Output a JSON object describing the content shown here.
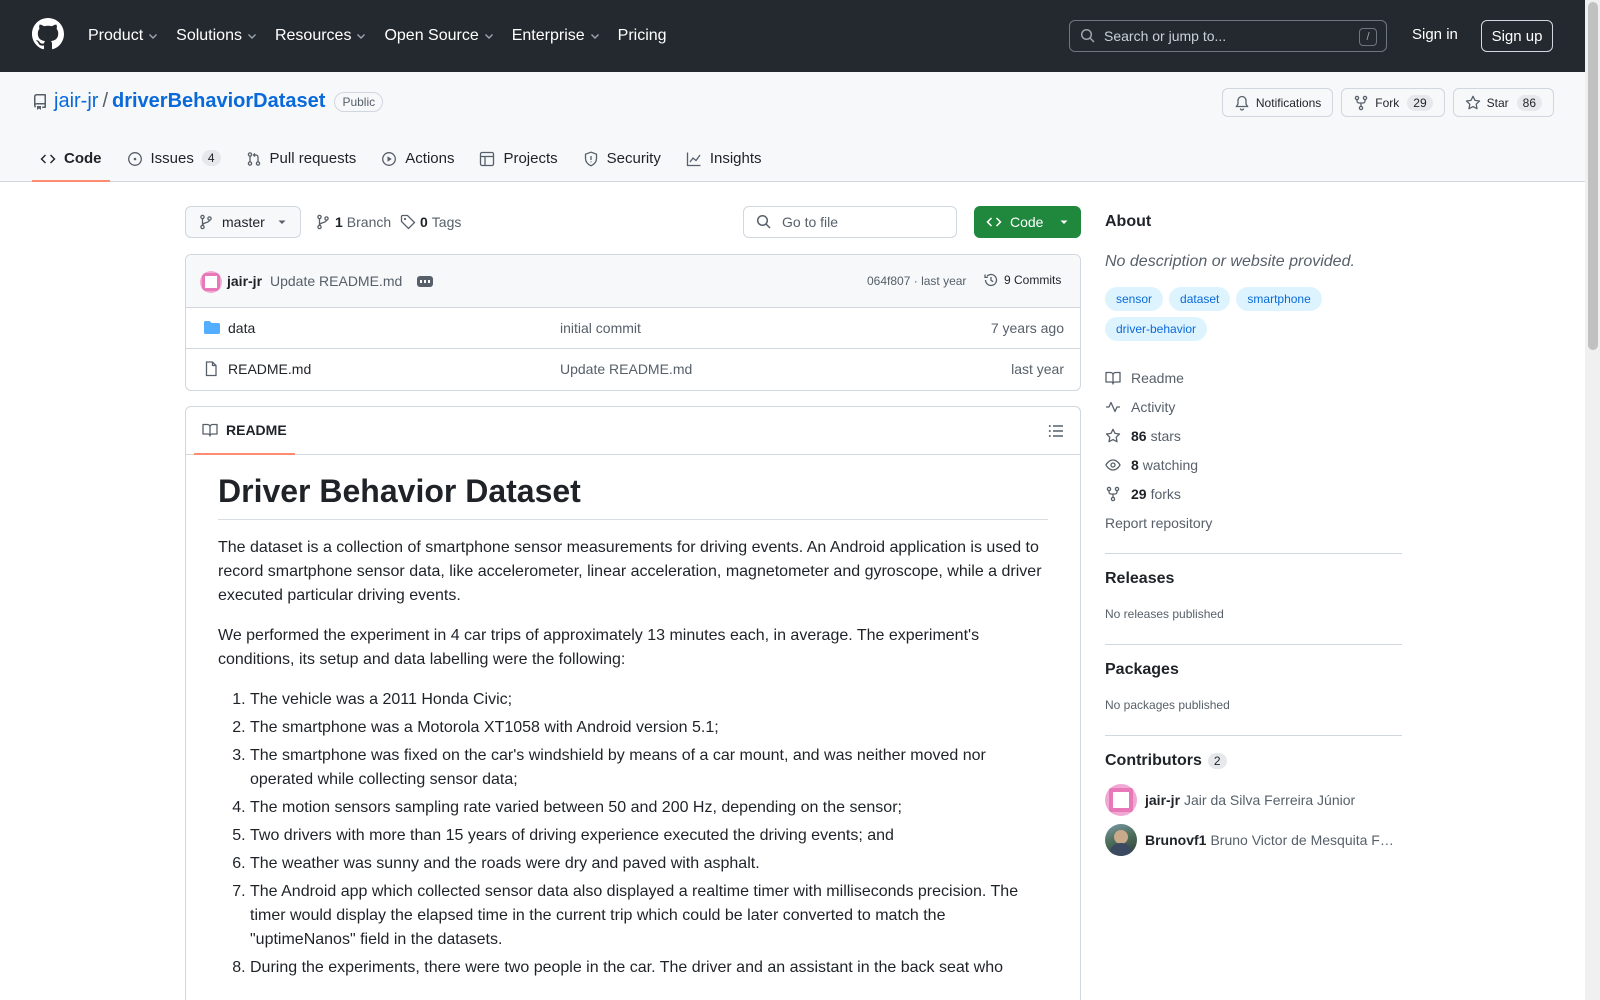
{
  "nav": {
    "items": [
      "Product",
      "Solutions",
      "Resources",
      "Open Source",
      "Enterprise",
      "Pricing"
    ],
    "search_placeholder": "Search or jump to...",
    "search_key": "/",
    "sign_in": "Sign in",
    "sign_up": "Sign up"
  },
  "repo": {
    "owner": "jair-jr",
    "separator": "/",
    "name": "driverBehaviorDataset",
    "visibility": "Public",
    "notifications_label": "Notifications",
    "fork_label": "Fork",
    "fork_count": "29",
    "star_label": "Star",
    "star_count": "86"
  },
  "tabs": [
    {
      "label": "Code",
      "active": true
    },
    {
      "label": "Issues",
      "count": "4"
    },
    {
      "label": "Pull requests"
    },
    {
      "label": "Actions"
    },
    {
      "label": "Projects"
    },
    {
      "label": "Security"
    },
    {
      "label": "Insights"
    }
  ],
  "toolbar": {
    "branch": "master",
    "branch_count": "1",
    "branch_label": "Branch",
    "tag_count": "0",
    "tag_label": "Tags",
    "goto_file": "Go to file",
    "code_label": "Code"
  },
  "commit": {
    "author": "jair-jr",
    "message": "Update README.md",
    "hash": "064f807",
    "sep": "·",
    "when": "last year",
    "commits": "9 Commits"
  },
  "files": [
    {
      "name": "data",
      "type": "folder",
      "message": "initial commit",
      "date": "7 years ago"
    },
    {
      "name": "README.md",
      "type": "file",
      "message": "Update README.md",
      "date": "last year"
    }
  ],
  "readme": {
    "tab_label": "README",
    "title": "Driver Behavior Dataset",
    "p1": "The dataset is a collection of smartphone sensor measurements for driving events. An Android application is used to record smartphone sensor data, like accelerometer, linear acceleration, magnetometer and gyroscope, while a driver executed particular driving events.",
    "p2": "We performed the experiment in 4 car trips of approximately 13 minutes each, in average. The experiment's conditions, its setup and data labelling were the following:",
    "list": [
      "The vehicle was a 2011 Honda Civic;",
      "The smartphone was a Motorola XT1058 with Android version 5.1;",
      "The smartphone was fixed on the car's windshield by means of a car mount, and was neither moved nor operated while collecting sensor data;",
      "The motion sensors sampling rate varied between 50 and 200 Hz, depending on the sensor;",
      "Two drivers with more than 15 years of driving experience executed the driving events; and",
      "The weather was sunny and the roads were dry and paved with asphalt.",
      "The Android app which collected sensor data also displayed a realtime timer with milliseconds precision. The timer would display the elapsed time in the current trip which could be later converted to match the \"uptimeNanos\" field in the datasets.",
      "During the experiments, there were two people in the car. The driver and an assistant in the back seat who"
    ]
  },
  "about": {
    "title": "About",
    "description": "No description or website provided.",
    "topics": [
      "sensor",
      "dataset",
      "smartphone",
      "driver-behavior"
    ],
    "links": [
      {
        "icon": "book-icon",
        "label": "Readme"
      },
      {
        "icon": "pulse-icon",
        "label": "Activity"
      },
      {
        "icon": "star-icon",
        "count": "86",
        "label": "stars"
      },
      {
        "icon": "eye-icon",
        "count": "8",
        "label": "watching"
      },
      {
        "icon": "fork-icon",
        "count": "29",
        "label": "forks"
      }
    ],
    "report": "Report repository"
  },
  "releases": {
    "title": "Releases",
    "text": "No releases published"
  },
  "packages": {
    "title": "Packages",
    "text": "No packages published"
  },
  "contributors": {
    "title": "Contributors",
    "count": "2",
    "list": [
      {
        "login": "jair-jr",
        "name": "Jair da Silva Ferreira Júnior"
      },
      {
        "login": "Brunovf1",
        "name": "Bruno Victor de Mesquita Ferreira"
      }
    ]
  }
}
